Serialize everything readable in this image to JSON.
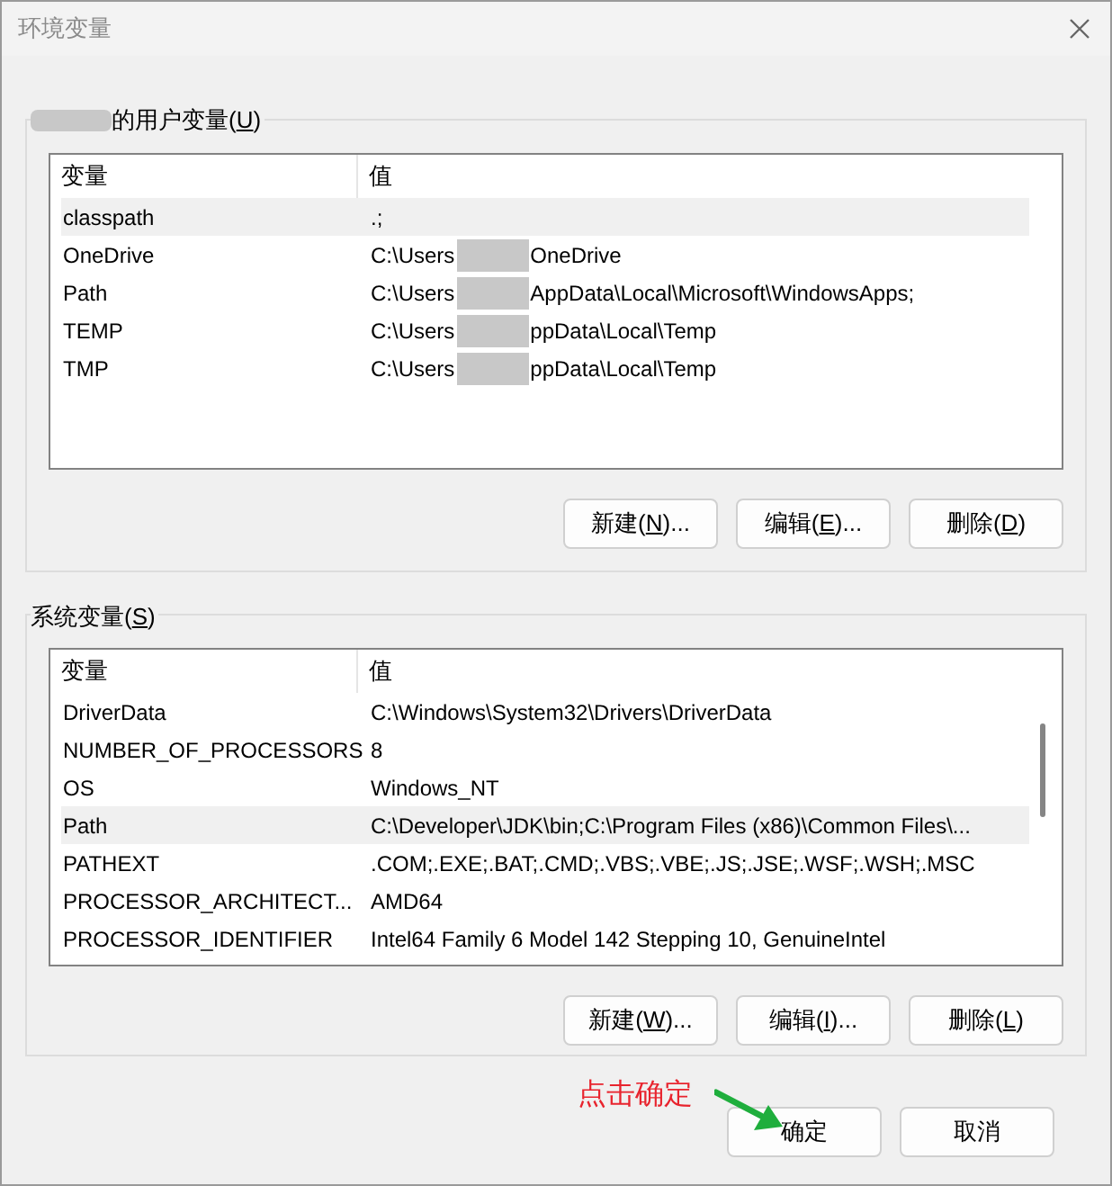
{
  "window": {
    "title": "环境变量"
  },
  "user_vars": {
    "label": "的用户变量",
    "label_key": {
      "pre": "(",
      "key": "U",
      "post": ")"
    },
    "label_redacted": true,
    "columns": [
      "变量",
      "值"
    ],
    "rows": [
      {
        "name": "classpath",
        "value": ".;",
        "selected": true,
        "redacted": false
      },
      {
        "name": "OneDrive",
        "value": "C:\\Users",
        "value_tail": "OneDrive",
        "selected": false,
        "redacted": true
      },
      {
        "name": "Path",
        "value": "C:\\Users",
        "value_tail": "AppData\\Local\\Microsoft\\WindowsApps;",
        "selected": false,
        "redacted": true
      },
      {
        "name": "TEMP",
        "value": "C:\\Users",
        "value_tail": "ppData\\Local\\Temp",
        "selected": false,
        "redacted": true
      },
      {
        "name": "TMP",
        "value": "C:\\Users",
        "value_tail": "ppData\\Local\\Temp",
        "selected": false,
        "redacted": true
      }
    ],
    "buttons": [
      {
        "pre": "新建(",
        "key": "N",
        "post": ")..."
      },
      {
        "pre": "编辑(",
        "key": "E",
        "post": ")..."
      },
      {
        "pre": "删除(",
        "key": "D",
        "post": ")"
      }
    ]
  },
  "system_vars": {
    "label": {
      "pre": "系统变量(",
      "key": "S",
      "post": ")"
    },
    "columns": [
      "变量",
      "值"
    ],
    "rows": [
      {
        "name": "DriverData",
        "value": "C:\\Windows\\System32\\Drivers\\DriverData",
        "selected": false
      },
      {
        "name": "NUMBER_OF_PROCESSORS",
        "value": "8",
        "selected": false
      },
      {
        "name": "OS",
        "value": "Windows_NT",
        "selected": false
      },
      {
        "name": "Path",
        "value": "C:\\Developer\\JDK\\bin;C:\\Program Files (x86)\\Common Files\\...",
        "selected": true
      },
      {
        "name": "PATHEXT",
        "value": ".COM;.EXE;.BAT;.CMD;.VBS;.VBE;.JS;.JSE;.WSF;.WSH;.MSC",
        "selected": false
      },
      {
        "name": "PROCESSOR_ARCHITECT...",
        "value": "AMD64",
        "selected": false
      },
      {
        "name": "PROCESSOR_IDENTIFIER",
        "value": "Intel64 Family 6 Model 142 Stepping 10, GenuineIntel",
        "selected": false
      }
    ],
    "buttons": [
      {
        "pre": "新建(",
        "key": "W",
        "post": ")..."
      },
      {
        "pre": "编辑(",
        "key": "I",
        "post": ")..."
      },
      {
        "pre": "删除(",
        "key": "L",
        "post": ")"
      }
    ]
  },
  "annotation": {
    "text": "点击确定"
  },
  "dialog_buttons": [
    "确定",
    "取消"
  ]
}
